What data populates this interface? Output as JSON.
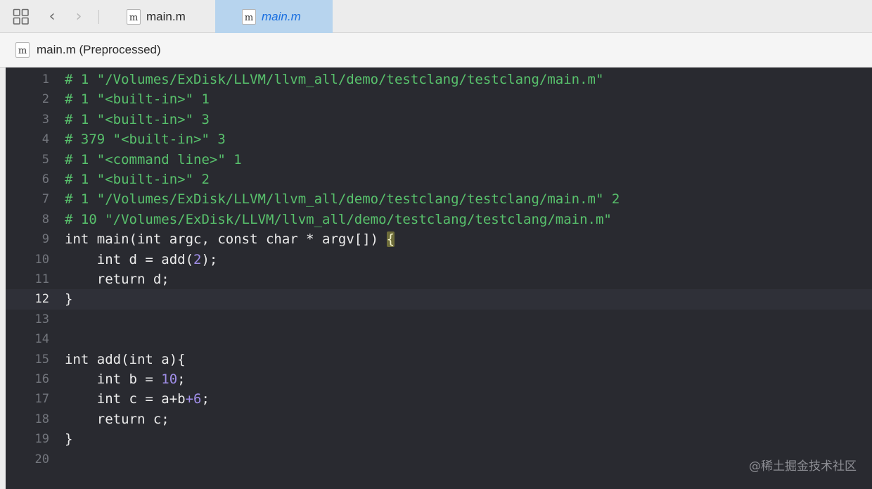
{
  "toolbar": {
    "grid_icon": "grid-icon",
    "back_glyph": "‹",
    "forward_glyph": "›"
  },
  "tabs": [
    {
      "label": "main.m",
      "icon_letter": "m",
      "active": false
    },
    {
      "label": "main.m",
      "icon_letter": "m",
      "active": true
    }
  ],
  "jumpbar": {
    "icon_letter": "m",
    "label": "main.m (Preprocessed)"
  },
  "editor": {
    "current_line": 12,
    "lines": [
      {
        "n": "1",
        "parts": [
          {
            "t": "# 1 \"/Volumes/ExDisk/LLVM/llvm_all/demo/testclang/testclang/main.m\"",
            "c": "pp"
          }
        ]
      },
      {
        "n": "2",
        "parts": [
          {
            "t": "# 1 \"<built-in>\" 1",
            "c": "pp"
          }
        ]
      },
      {
        "n": "3",
        "parts": [
          {
            "t": "# 1 \"<built-in>\" 3",
            "c": "pp"
          }
        ]
      },
      {
        "n": "4",
        "parts": [
          {
            "t": "# 379 \"<built-in>\" 3",
            "c": "pp"
          }
        ]
      },
      {
        "n": "5",
        "parts": [
          {
            "t": "# 1 \"<command line>\" 1",
            "c": "pp"
          }
        ]
      },
      {
        "n": "6",
        "parts": [
          {
            "t": "# 1 \"<built-in>\" 2",
            "c": "pp"
          }
        ]
      },
      {
        "n": "7",
        "parts": [
          {
            "t": "# 1 \"/Volumes/ExDisk/LLVM/llvm_all/demo/testclang/testclang/main.m\" 2",
            "c": "pp"
          }
        ]
      },
      {
        "n": "8",
        "parts": [
          {
            "t": "# 10 \"/Volumes/ExDisk/LLVM/llvm_all/demo/testclang/testclang/main.m\"",
            "c": "pp"
          }
        ]
      },
      {
        "n": "9",
        "parts": [
          {
            "t": "int main(int argc, const char * argv[]) ",
            "c": "plain"
          },
          {
            "t": "{",
            "c": "brace-hl"
          }
        ]
      },
      {
        "n": "10",
        "parts": [
          {
            "t": "    int d = add(",
            "c": "plain"
          },
          {
            "t": "2",
            "c": "num"
          },
          {
            "t": ");",
            "c": "plain"
          }
        ]
      },
      {
        "n": "11",
        "parts": [
          {
            "t": "    return d;",
            "c": "plain"
          }
        ]
      },
      {
        "n": "12",
        "parts": [
          {
            "t": "}",
            "c": "plain"
          }
        ]
      },
      {
        "n": "13",
        "parts": []
      },
      {
        "n": "14",
        "parts": []
      },
      {
        "n": "15",
        "parts": [
          {
            "t": "int add(int a){",
            "c": "plain"
          }
        ]
      },
      {
        "n": "16",
        "parts": [
          {
            "t": "    int b = ",
            "c": "plain"
          },
          {
            "t": "10",
            "c": "num"
          },
          {
            "t": ";",
            "c": "plain"
          }
        ]
      },
      {
        "n": "17",
        "parts": [
          {
            "t": "    int c = a+b",
            "c": "plain"
          },
          {
            "t": "+6",
            "c": "num"
          },
          {
            "t": ";",
            "c": "plain"
          }
        ]
      },
      {
        "n": "18",
        "parts": [
          {
            "t": "    return c;",
            "c": "plain"
          }
        ]
      },
      {
        "n": "19",
        "parts": [
          {
            "t": "}",
            "c": "plain"
          }
        ]
      },
      {
        "n": "20",
        "parts": []
      }
    ]
  },
  "watermark": "@稀土掘金技术社区",
  "colors": {
    "editor_bg": "#292a30",
    "preprocessor": "#58c16c",
    "number": "#a08ee8",
    "plain": "#ececec",
    "active_tab": "#b7d4ee"
  }
}
